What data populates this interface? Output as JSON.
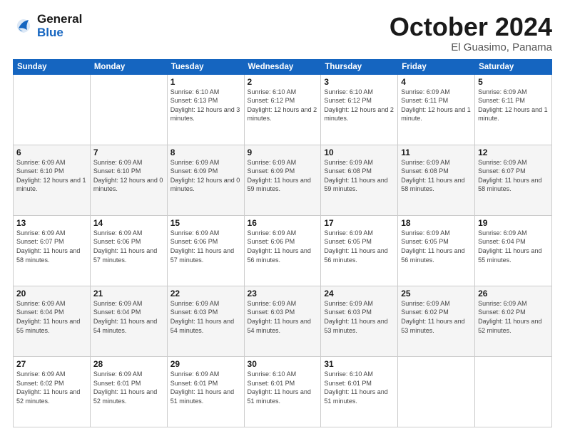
{
  "header": {
    "logo_line1": "General",
    "logo_line2": "Blue",
    "month": "October 2024",
    "location": "El Guasimo, Panama"
  },
  "weekdays": [
    "Sunday",
    "Monday",
    "Tuesday",
    "Wednesday",
    "Thursday",
    "Friday",
    "Saturday"
  ],
  "weeks": [
    [
      {
        "day": "",
        "info": ""
      },
      {
        "day": "",
        "info": ""
      },
      {
        "day": "1",
        "info": "Sunrise: 6:10 AM\nSunset: 6:13 PM\nDaylight: 12 hours\nand 3 minutes."
      },
      {
        "day": "2",
        "info": "Sunrise: 6:10 AM\nSunset: 6:12 PM\nDaylight: 12 hours\nand 2 minutes."
      },
      {
        "day": "3",
        "info": "Sunrise: 6:10 AM\nSunset: 6:12 PM\nDaylight: 12 hours\nand 2 minutes."
      },
      {
        "day": "4",
        "info": "Sunrise: 6:09 AM\nSunset: 6:11 PM\nDaylight: 12 hours\nand 1 minute."
      },
      {
        "day": "5",
        "info": "Sunrise: 6:09 AM\nSunset: 6:11 PM\nDaylight: 12 hours\nand 1 minute."
      }
    ],
    [
      {
        "day": "6",
        "info": "Sunrise: 6:09 AM\nSunset: 6:10 PM\nDaylight: 12 hours\nand 1 minute."
      },
      {
        "day": "7",
        "info": "Sunrise: 6:09 AM\nSunset: 6:10 PM\nDaylight: 12 hours\nand 0 minutes."
      },
      {
        "day": "8",
        "info": "Sunrise: 6:09 AM\nSunset: 6:09 PM\nDaylight: 12 hours\nand 0 minutes."
      },
      {
        "day": "9",
        "info": "Sunrise: 6:09 AM\nSunset: 6:09 PM\nDaylight: 11 hours\nand 59 minutes."
      },
      {
        "day": "10",
        "info": "Sunrise: 6:09 AM\nSunset: 6:08 PM\nDaylight: 11 hours\nand 59 minutes."
      },
      {
        "day": "11",
        "info": "Sunrise: 6:09 AM\nSunset: 6:08 PM\nDaylight: 11 hours\nand 58 minutes."
      },
      {
        "day": "12",
        "info": "Sunrise: 6:09 AM\nSunset: 6:07 PM\nDaylight: 11 hours\nand 58 minutes."
      }
    ],
    [
      {
        "day": "13",
        "info": "Sunrise: 6:09 AM\nSunset: 6:07 PM\nDaylight: 11 hours\nand 58 minutes."
      },
      {
        "day": "14",
        "info": "Sunrise: 6:09 AM\nSunset: 6:06 PM\nDaylight: 11 hours\nand 57 minutes."
      },
      {
        "day": "15",
        "info": "Sunrise: 6:09 AM\nSunset: 6:06 PM\nDaylight: 11 hours\nand 57 minutes."
      },
      {
        "day": "16",
        "info": "Sunrise: 6:09 AM\nSunset: 6:06 PM\nDaylight: 11 hours\nand 56 minutes."
      },
      {
        "day": "17",
        "info": "Sunrise: 6:09 AM\nSunset: 6:05 PM\nDaylight: 11 hours\nand 56 minutes."
      },
      {
        "day": "18",
        "info": "Sunrise: 6:09 AM\nSunset: 6:05 PM\nDaylight: 11 hours\nand 56 minutes."
      },
      {
        "day": "19",
        "info": "Sunrise: 6:09 AM\nSunset: 6:04 PM\nDaylight: 11 hours\nand 55 minutes."
      }
    ],
    [
      {
        "day": "20",
        "info": "Sunrise: 6:09 AM\nSunset: 6:04 PM\nDaylight: 11 hours\nand 55 minutes."
      },
      {
        "day": "21",
        "info": "Sunrise: 6:09 AM\nSunset: 6:04 PM\nDaylight: 11 hours\nand 54 minutes."
      },
      {
        "day": "22",
        "info": "Sunrise: 6:09 AM\nSunset: 6:03 PM\nDaylight: 11 hours\nand 54 minutes."
      },
      {
        "day": "23",
        "info": "Sunrise: 6:09 AM\nSunset: 6:03 PM\nDaylight: 11 hours\nand 54 minutes."
      },
      {
        "day": "24",
        "info": "Sunrise: 6:09 AM\nSunset: 6:03 PM\nDaylight: 11 hours\nand 53 minutes."
      },
      {
        "day": "25",
        "info": "Sunrise: 6:09 AM\nSunset: 6:02 PM\nDaylight: 11 hours\nand 53 minutes."
      },
      {
        "day": "26",
        "info": "Sunrise: 6:09 AM\nSunset: 6:02 PM\nDaylight: 11 hours\nand 52 minutes."
      }
    ],
    [
      {
        "day": "27",
        "info": "Sunrise: 6:09 AM\nSunset: 6:02 PM\nDaylight: 11 hours\nand 52 minutes."
      },
      {
        "day": "28",
        "info": "Sunrise: 6:09 AM\nSunset: 6:01 PM\nDaylight: 11 hours\nand 52 minutes."
      },
      {
        "day": "29",
        "info": "Sunrise: 6:09 AM\nSunset: 6:01 PM\nDaylight: 11 hours\nand 51 minutes."
      },
      {
        "day": "30",
        "info": "Sunrise: 6:10 AM\nSunset: 6:01 PM\nDaylight: 11 hours\nand 51 minutes."
      },
      {
        "day": "31",
        "info": "Sunrise: 6:10 AM\nSunset: 6:01 PM\nDaylight: 11 hours\nand 51 minutes."
      },
      {
        "day": "",
        "info": ""
      },
      {
        "day": "",
        "info": ""
      }
    ]
  ]
}
